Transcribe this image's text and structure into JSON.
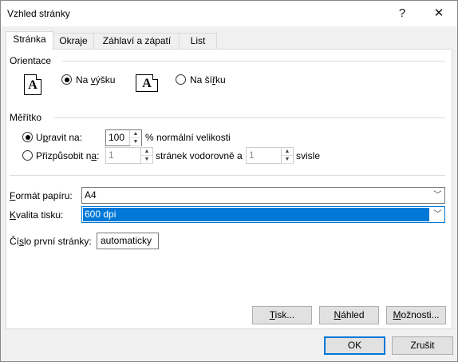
{
  "window": {
    "title": "Vzhled stránky",
    "help_glyph": "?",
    "close_glyph": "✕"
  },
  "tabs": [
    "Stránka",
    "Okraje",
    "Záhlaví a zápatí",
    "List"
  ],
  "orientation": {
    "label": "Orientace",
    "portrait_label": "Na výšku",
    "landscape_label": "Na šířku",
    "icon_letter": "A",
    "selected": "portrait"
  },
  "scaling": {
    "label": "Měřítko",
    "adjust_label": "Upravit na:",
    "adjust_value": "100",
    "adjust_suffix": "% normální velikosti",
    "fit_label": "Přizpůsobit na:",
    "fit_wide_value": "1",
    "fit_wide_suffix": "stránek vodorovně a",
    "fit_tall_value": "1",
    "fit_tall_suffix": "svisle",
    "selected": "adjust"
  },
  "paper": {
    "size_label": "Formát papíru:",
    "size_value": "A4",
    "quality_label": "Kvalita tisku:",
    "quality_value": "600 dpi",
    "first_page_label": "Číslo první stránky:",
    "first_page_value": "automaticky"
  },
  "actions": {
    "print": "Tisk...",
    "preview": "Náhled",
    "options": "Možnosti..."
  },
  "footer": {
    "ok": "OK",
    "cancel": "Zrušit"
  },
  "colors": {
    "accent": "#0078d7",
    "panel_bg": "#ffffff",
    "dialog_bg": "#f0f0f0"
  }
}
